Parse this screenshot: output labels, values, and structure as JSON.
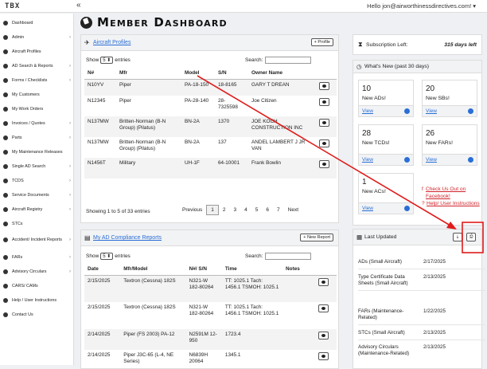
{
  "topbar": {
    "logo": "TBX",
    "collapse": "«",
    "greeting": "Hello jon@airworthinessdirectives.com! ▾"
  },
  "sidebar": {
    "items": [
      {
        "label": "Dashboard",
        "chevron": ""
      },
      {
        "label": "Admin",
        "chevron": "›"
      },
      {
        "label": "Aircraft Profiles",
        "chevron": ""
      },
      {
        "label": "AD Search & Reports",
        "chevron": "›"
      },
      {
        "label": "Forms / Checklists",
        "chevron": "›"
      },
      {
        "label": "My Customers",
        "chevron": ""
      },
      {
        "label": "My Work Orders",
        "chevron": ""
      },
      {
        "label": "Invoices / Quotes",
        "chevron": "›"
      },
      {
        "label": "Parts",
        "chevron": "›"
      },
      {
        "label": "My Maintenance Releases",
        "chevron": ""
      },
      {
        "label": "Single AD Search",
        "chevron": "›"
      },
      {
        "label": "TCDS",
        "chevron": "›"
      },
      {
        "label": "Service Documents",
        "chevron": "›"
      },
      {
        "label": "Aircraft Registry",
        "chevron": "›"
      },
      {
        "label": "STCs",
        "chevron": ""
      },
      {
        "label": "Accident/ Incident Reports",
        "chevron": "›"
      },
      {
        "label": "FARs",
        "chevron": "›"
      },
      {
        "label": "Advisory Circulars",
        "chevron": "›"
      },
      {
        "label": "CARS/ CAMs",
        "chevron": ""
      },
      {
        "label": "Help / User Instructions",
        "chevron": ""
      },
      {
        "label": "Contact Us",
        "chevron": ""
      }
    ]
  },
  "page": {
    "title": "Member Dashboard"
  },
  "aircraft": {
    "title": "Aircraft Profiles",
    "add_button": "+ Profile",
    "show_label": "Show",
    "show_value": "5 ⬍",
    "entries_label": "entries",
    "search_label": "Search:",
    "columns": [
      "N#",
      "Mfr",
      "Model",
      "S/N",
      "Owner Name",
      ""
    ],
    "rows": [
      [
        "N10YV",
        "Piper",
        "PA-18-150",
        "18-8165",
        "GARY T DREAN"
      ],
      [
        "N12345",
        "Piper",
        "PA-28-140",
        "28-7325598",
        "Joe Citizen"
      ],
      [
        "N137MW",
        "Britten-Norman (B-N Group) (Pilatus)",
        "BN-2A",
        "1370",
        "JOE KOCH CONSTRUCTION INC"
      ],
      [
        "N137MW",
        "Britten-Norman (B-N Group) (Pilatus)",
        "BN-2A",
        "137",
        "ANDEL LAMBERT J JR VAN"
      ],
      [
        "N1456T",
        "Military",
        "UH-1F",
        "64-10001",
        "Frank Bowlin"
      ]
    ],
    "footer": "Showing 1 to 5 of 33 entries",
    "pagination": [
      "Previous",
      "1",
      "2",
      "3",
      "4",
      "5",
      "6",
      "7",
      "Next"
    ]
  },
  "compliance": {
    "title": "My AD Compliance Reports",
    "add_button": "+ New Report",
    "show_label": "Show",
    "show_value": "5 ⬍",
    "entries_label": "entries",
    "search_label": "Search:",
    "columns": [
      "Date",
      "Mfr/Model",
      "N#/ S/N",
      "Time",
      "Notes",
      ""
    ],
    "rows": [
      [
        "2/15/2025",
        "Textron (Cessna) 182S",
        "N321-W 182-80264",
        "TT: 1025.1 Tach: 1456.1 TSMOH: 1025.1",
        ""
      ],
      [
        "2/15/2025",
        "Textron (Cessna) 182S",
        "N321-W 182-80264",
        "TT: 1025.1 Tach: 1456.1 TSMOH: 1025.1",
        ""
      ],
      [
        "2/14/2025",
        "Piper (FS 2003) PA-12",
        "N2591M 12-950",
        "1723.4",
        ""
      ],
      [
        "2/14/2025",
        "Piper J3C-65 (L-4, NE Series)",
        "N6839H 20064",
        "1345.1",
        ""
      ]
    ]
  },
  "subscription": {
    "label": "Subscription Left:",
    "value": "315 days left"
  },
  "whatsnew": {
    "title": "What's New (past 30 days)",
    "tiles": [
      {
        "num": "10",
        "label": "New ADs!",
        "view": "View"
      },
      {
        "num": "20",
        "label": "New SBs!",
        "view": "View"
      },
      {
        "num": "28",
        "label": "New TCDs!",
        "view": "View"
      },
      {
        "num": "26",
        "label": "New FARs!",
        "view": "View"
      },
      {
        "num": "1",
        "label": "New ACs!",
        "view": "View"
      }
    ],
    "facebook": "Check Us Out on Facebook!",
    "help": "Help/ User Instructions"
  },
  "lastupdated": {
    "title": "Last Updated",
    "rows": [
      [
        "ADs (Small Aircraft)",
        "2/17/2025"
      ],
      [
        "Type Certificate Data Sheets (Small Aircraft)",
        "2/13/2025"
      ],
      [
        "FARs (Maintenance-Related)",
        "1/22/2025"
      ],
      [
        "STCs (Small Aircraft)",
        "2/13/2025"
      ],
      [
        "Advisory Circulars (Maintenance-Related)",
        "2/13/2025"
      ]
    ]
  },
  "colors": {
    "accent": "#2a6fd6",
    "annotation": "#e01b1b"
  }
}
